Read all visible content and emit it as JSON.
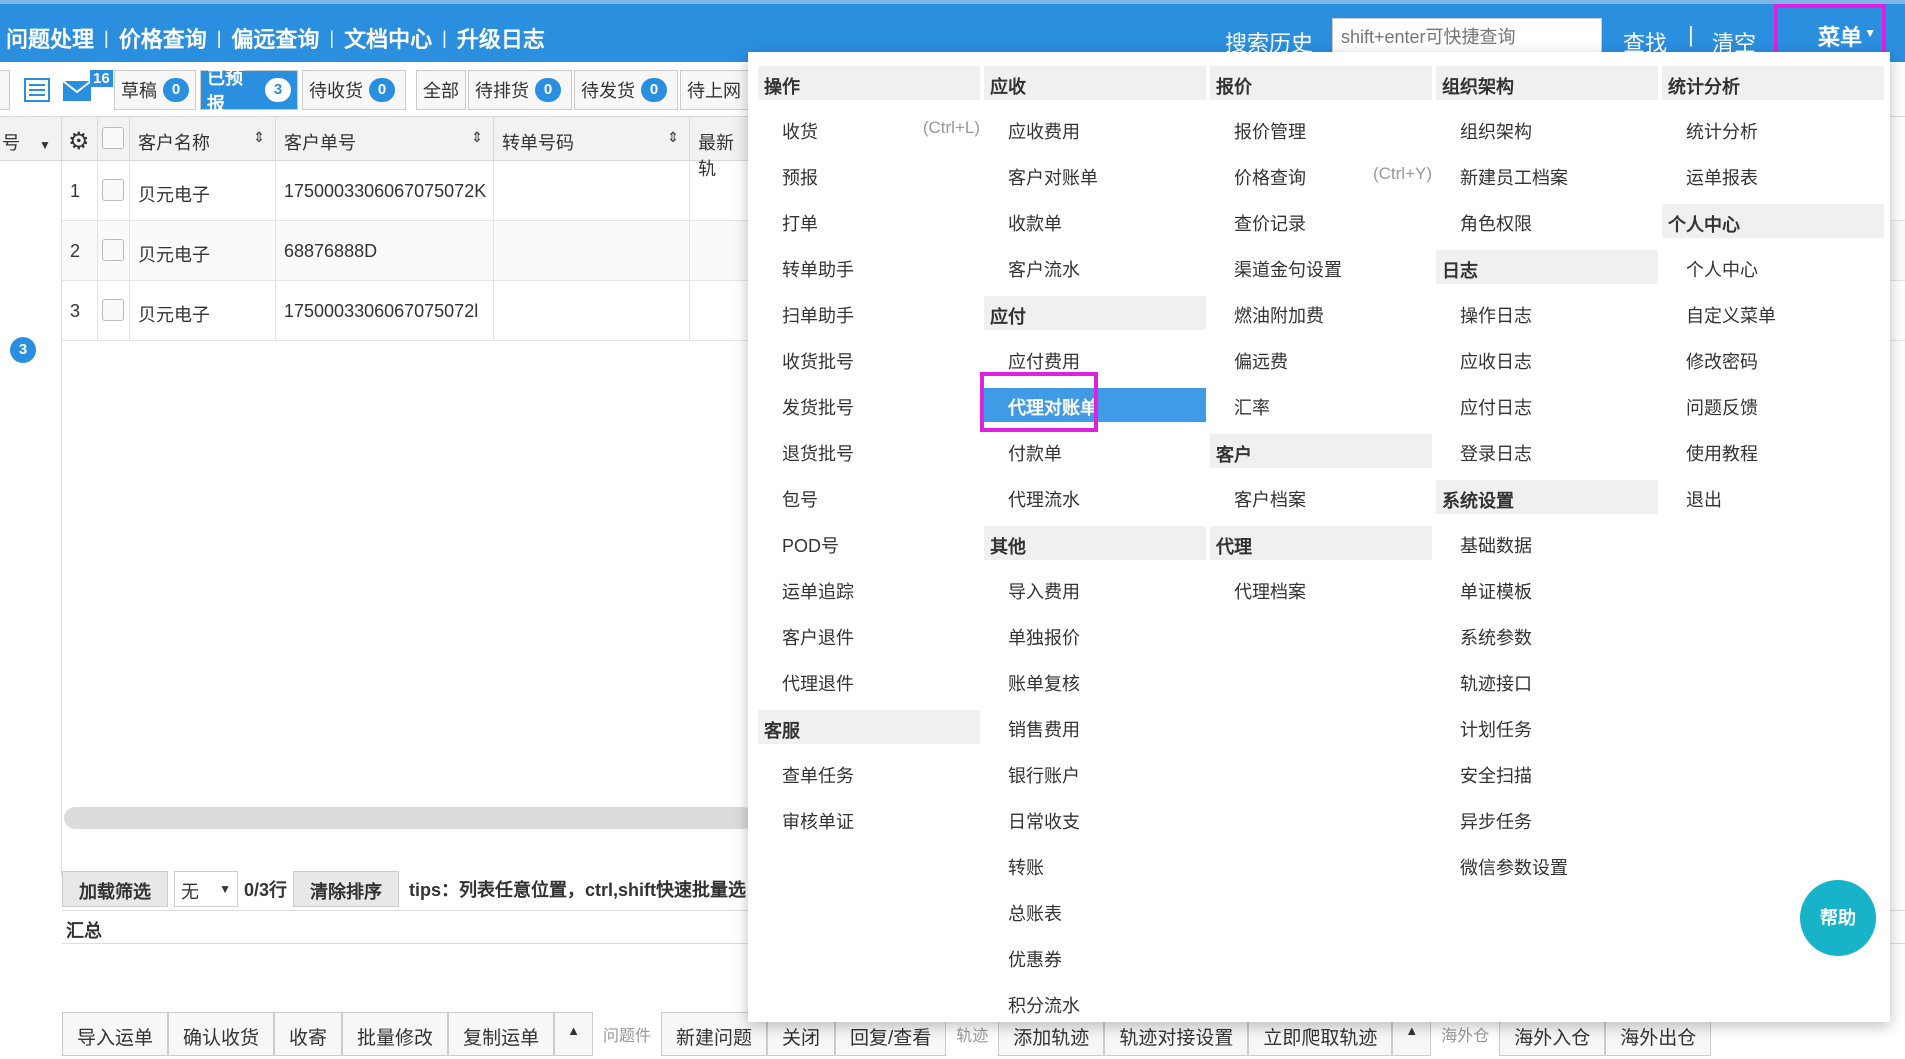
{
  "topnav": [
    "问题处理",
    "价格查询",
    "偏远查询",
    "文档中心",
    "升级日志"
  ],
  "topbar": {
    "history": "搜索历史",
    "search_placeholder": "shift+enter可快捷查询",
    "find": "查找",
    "divider": "|",
    "clear": "清空",
    "menu": "菜单"
  },
  "toolbar": {
    "mail_count": "16",
    "tabs": [
      {
        "label": "草稿",
        "count": "0"
      },
      {
        "label": "已预报",
        "count": "3"
      },
      {
        "label": "待收货",
        "count": "0"
      },
      {
        "label": "全部",
        "count": ""
      },
      {
        "label": "待排货",
        "count": "0"
      },
      {
        "label": "待发货",
        "count": "0"
      },
      {
        "label": "待上网",
        "count": ""
      }
    ]
  },
  "grid": {
    "headers": [
      "号",
      "客户名称",
      "客户单号",
      "转单号码",
      "最新轨"
    ],
    "rows": [
      {
        "no": "1",
        "customer": "贝元电子",
        "order": "1750003306067075072K"
      },
      {
        "no": "2",
        "customer": "贝元电子",
        "order": "68876888D"
      },
      {
        "no": "3",
        "customer": "贝元电子",
        "order": "1750003306067075072l"
      }
    ],
    "left_badge": "3"
  },
  "filterbar": {
    "load": "加载筛选",
    "none": "无",
    "rows": "0/3行",
    "clear_sort": "清除排序",
    "tips": "tips：列表任意位置，ctrl,shift快速批量选"
  },
  "summary": "汇总",
  "actions": {
    "group1": [
      "导入运单",
      "确认收货",
      "收寄",
      "批量修改",
      "复制运单"
    ],
    "label_problem": "问题件",
    "group2": [
      "新建问题",
      "关闭",
      "回复/查看"
    ],
    "label_track": "轨迹",
    "group3": [
      "添加轨迹",
      "轨迹对接设置",
      "立即爬取轨迹"
    ],
    "label_overseas": "海外仓",
    "group4": [
      "海外入仓",
      "海外出仓"
    ]
  },
  "help": "帮助",
  "menu": {
    "col1": [
      {
        "head": "操作",
        "items": [
          {
            "label": "收货",
            "shortcut": "(Ctrl+L)"
          },
          {
            "label": "预报"
          },
          {
            "label": "打单"
          },
          {
            "label": "转单助手"
          },
          {
            "label": "扫单助手"
          },
          {
            "label": "收货批号"
          },
          {
            "label": "发货批号"
          },
          {
            "label": "退货批号"
          },
          {
            "label": "包号"
          },
          {
            "label": "POD号"
          },
          {
            "label": "运单追踪"
          },
          {
            "label": "客户退件"
          },
          {
            "label": "代理退件"
          }
        ]
      },
      {
        "head": "客服",
        "items": [
          {
            "label": "查单任务"
          },
          {
            "label": "审核单证"
          }
        ]
      }
    ],
    "col2": [
      {
        "head": "应收",
        "items": [
          {
            "label": "应收费用"
          },
          {
            "label": "客户对账单"
          },
          {
            "label": "收款单"
          },
          {
            "label": "客户流水"
          }
        ]
      },
      {
        "head": "应付",
        "items": [
          {
            "label": "应付费用"
          },
          {
            "label": "代理对账单",
            "selected": true
          },
          {
            "label": "付款单"
          },
          {
            "label": "代理流水"
          }
        ]
      },
      {
        "head": "其他",
        "items": [
          {
            "label": "导入费用"
          },
          {
            "label": "单独报价"
          },
          {
            "label": "账单复核"
          },
          {
            "label": "销售费用"
          },
          {
            "label": "银行账户"
          },
          {
            "label": "日常收支"
          },
          {
            "label": "转账"
          },
          {
            "label": "总账表"
          },
          {
            "label": "优惠券"
          },
          {
            "label": "积分流水"
          }
        ]
      }
    ],
    "col3": [
      {
        "head": "报价",
        "items": [
          {
            "label": "报价管理"
          },
          {
            "label": "价格查询",
            "shortcut": "(Ctrl+Y)"
          },
          {
            "label": "查价记录"
          },
          {
            "label": "渠道金句设置"
          },
          {
            "label": "燃油附加费"
          },
          {
            "label": "偏远费"
          },
          {
            "label": "汇率"
          }
        ]
      },
      {
        "head": "客户",
        "items": [
          {
            "label": "客户档案"
          }
        ]
      },
      {
        "head": "代理",
        "items": [
          {
            "label": "代理档案"
          }
        ]
      }
    ],
    "col4": [
      {
        "head": "组织架构",
        "items": [
          {
            "label": "组织架构"
          },
          {
            "label": "新建员工档案"
          },
          {
            "label": "角色权限"
          }
        ]
      },
      {
        "head": "日志",
        "items": [
          {
            "label": "操作日志"
          },
          {
            "label": "应收日志"
          },
          {
            "label": "应付日志"
          },
          {
            "label": "登录日志"
          }
        ]
      },
      {
        "head": "系统设置",
        "items": [
          {
            "label": "基础数据"
          },
          {
            "label": "单证模板"
          },
          {
            "label": "系统参数"
          },
          {
            "label": "轨迹接口"
          },
          {
            "label": "计划任务"
          },
          {
            "label": "安全扫描"
          },
          {
            "label": "异步任务"
          },
          {
            "label": "微信参数设置"
          }
        ]
      }
    ],
    "col5": [
      {
        "head": "统计分析",
        "items": [
          {
            "label": "统计分析"
          },
          {
            "label": "运单报表"
          }
        ]
      },
      {
        "head": "个人中心",
        "items": [
          {
            "label": "个人中心"
          },
          {
            "label": "自定义菜单"
          },
          {
            "label": "修改密码"
          },
          {
            "label": "问题反馈"
          },
          {
            "label": "使用教程"
          },
          {
            "label": "退出"
          }
        ]
      }
    ]
  }
}
